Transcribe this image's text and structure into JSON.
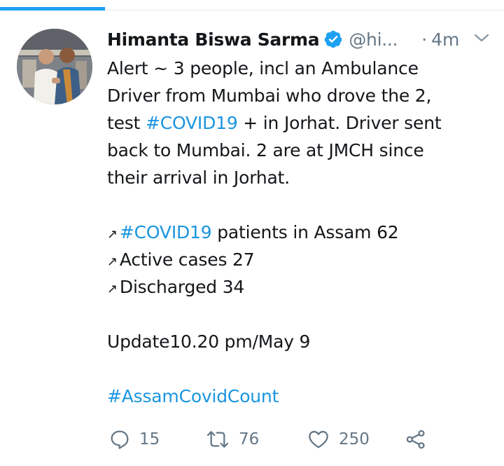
{
  "tweet": {
    "author_name": "Himanta Biswa Sarma",
    "handle": "@hi...",
    "dot": "·",
    "time": "4m",
    "lines": [
      "Alert ~ 3 people, incl an Ambulance",
      "Driver from Mumbai who drove the 2,",
      {
        "before": "test ",
        "hashtag": "#COVID19",
        "after": " + in Jorhat. Driver sent"
      },
      "back to Mumbai. 2 are at JMCH since",
      "their arrival in Jorhat."
    ],
    "stats": {
      "arrow": "↗",
      "row1_hashtag": "#COVID19",
      "row1_text": " patients in Assam 62",
      "row2_text": "Active cases 27",
      "row3_text": "Discharged 34"
    },
    "update": "Update10.20 pm/May 9",
    "footer_hashtag": "#AssamCovidCount"
  },
  "actions": {
    "replies": "15",
    "retweets": "76",
    "likes": "250"
  },
  "icons": {
    "verified": "verified-badge-icon",
    "chevron": "chevron-down-icon",
    "reply": "reply-icon",
    "retweet": "retweet-icon",
    "like": "heart-icon",
    "share": "share-icon"
  },
  "colors": {
    "accent": "#1da1f2",
    "hashtag": "#1b95e0",
    "muted": "#657786"
  }
}
